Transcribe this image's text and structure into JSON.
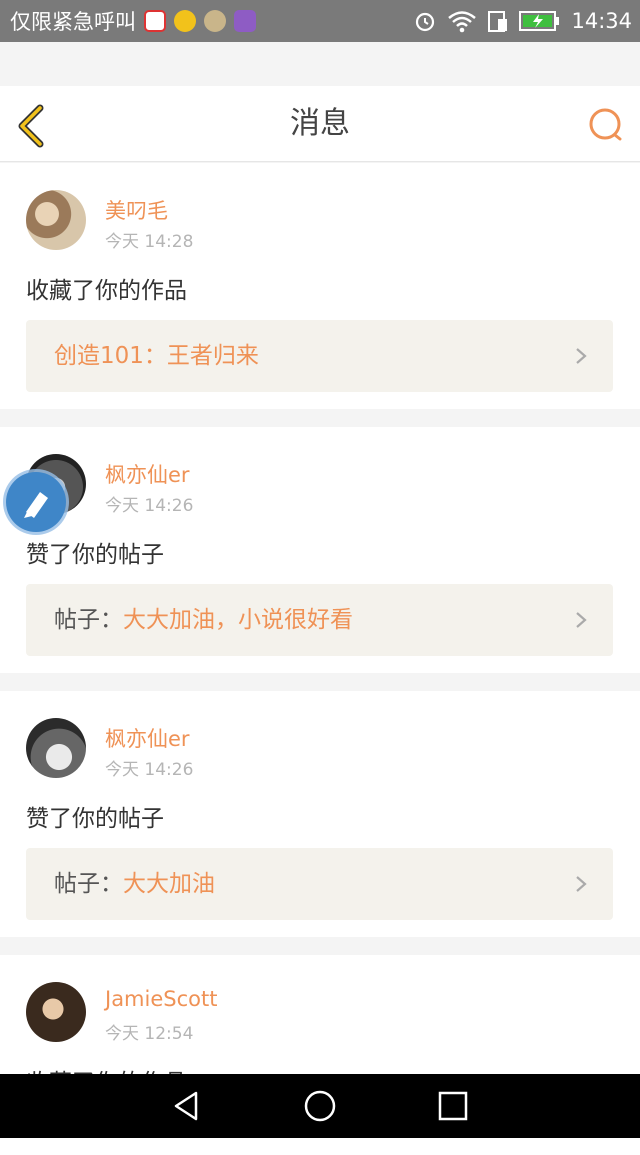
{
  "status_bar": {
    "carrier": "仅限紧急呼叫",
    "time": "14:34",
    "icons": [
      "alarm-icon",
      "wifi-icon",
      "sim-icon",
      "battery-charging-icon"
    ]
  },
  "header": {
    "title": "消息",
    "back_icon": "chevron-left-icon",
    "search_icon": "search-icon",
    "accent_color": "#ef9256"
  },
  "messages": [
    {
      "username": "美叼毛",
      "time": "今天 14:28",
      "action": "收藏了你的作品",
      "link_prefix": "",
      "link_text": "创造101：王者归来"
    },
    {
      "username": "枫亦仙er",
      "time": "今天 14:26",
      "action": "赞了你的帖子",
      "link_prefix": "帖子：",
      "link_text": "大大加油，小说很好看"
    },
    {
      "username": "枫亦仙er",
      "time": "今天 14:26",
      "action": "赞了你的帖子",
      "link_prefix": "帖子：",
      "link_text": "大大加油"
    },
    {
      "username": "JamieScott",
      "time": "今天 12:54",
      "action": "收藏了你的作品"
    }
  ]
}
